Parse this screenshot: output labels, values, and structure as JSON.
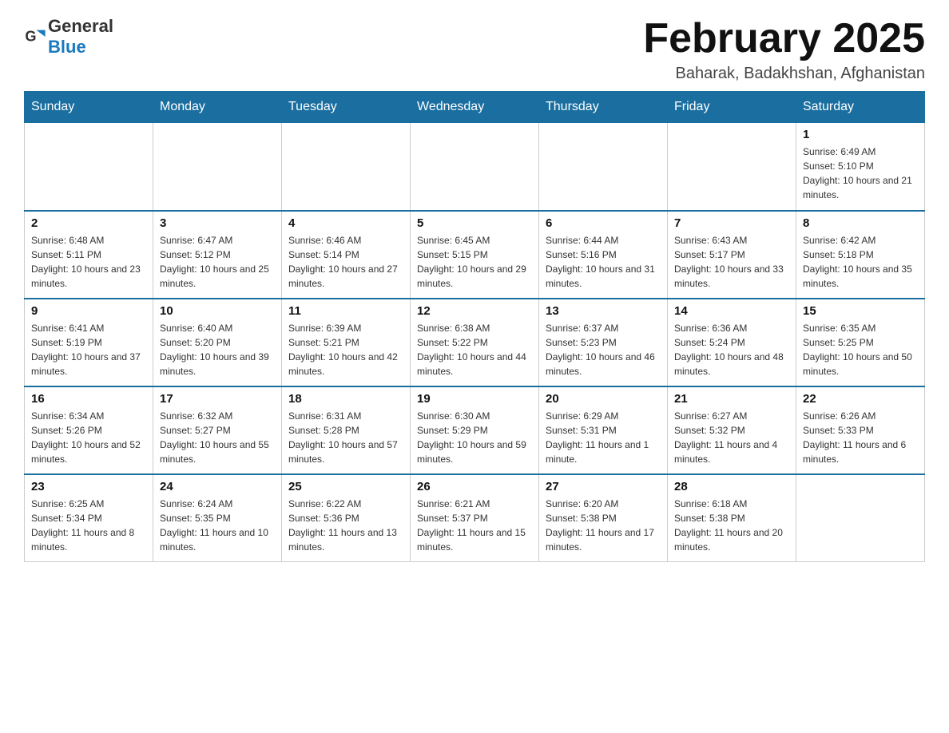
{
  "header": {
    "logo_general": "General",
    "logo_blue": "Blue",
    "month_title": "February 2025",
    "location": "Baharak, Badakhshan, Afghanistan"
  },
  "days_of_week": [
    "Sunday",
    "Monday",
    "Tuesday",
    "Wednesday",
    "Thursday",
    "Friday",
    "Saturday"
  ],
  "weeks": [
    [
      {
        "day": "",
        "info": ""
      },
      {
        "day": "",
        "info": ""
      },
      {
        "day": "",
        "info": ""
      },
      {
        "day": "",
        "info": ""
      },
      {
        "day": "",
        "info": ""
      },
      {
        "day": "",
        "info": ""
      },
      {
        "day": "1",
        "info": "Sunrise: 6:49 AM\nSunset: 5:10 PM\nDaylight: 10 hours and 21 minutes."
      }
    ],
    [
      {
        "day": "2",
        "info": "Sunrise: 6:48 AM\nSunset: 5:11 PM\nDaylight: 10 hours and 23 minutes."
      },
      {
        "day": "3",
        "info": "Sunrise: 6:47 AM\nSunset: 5:12 PM\nDaylight: 10 hours and 25 minutes."
      },
      {
        "day": "4",
        "info": "Sunrise: 6:46 AM\nSunset: 5:14 PM\nDaylight: 10 hours and 27 minutes."
      },
      {
        "day": "5",
        "info": "Sunrise: 6:45 AM\nSunset: 5:15 PM\nDaylight: 10 hours and 29 minutes."
      },
      {
        "day": "6",
        "info": "Sunrise: 6:44 AM\nSunset: 5:16 PM\nDaylight: 10 hours and 31 minutes."
      },
      {
        "day": "7",
        "info": "Sunrise: 6:43 AM\nSunset: 5:17 PM\nDaylight: 10 hours and 33 minutes."
      },
      {
        "day": "8",
        "info": "Sunrise: 6:42 AM\nSunset: 5:18 PM\nDaylight: 10 hours and 35 minutes."
      }
    ],
    [
      {
        "day": "9",
        "info": "Sunrise: 6:41 AM\nSunset: 5:19 PM\nDaylight: 10 hours and 37 minutes."
      },
      {
        "day": "10",
        "info": "Sunrise: 6:40 AM\nSunset: 5:20 PM\nDaylight: 10 hours and 39 minutes."
      },
      {
        "day": "11",
        "info": "Sunrise: 6:39 AM\nSunset: 5:21 PM\nDaylight: 10 hours and 42 minutes."
      },
      {
        "day": "12",
        "info": "Sunrise: 6:38 AM\nSunset: 5:22 PM\nDaylight: 10 hours and 44 minutes."
      },
      {
        "day": "13",
        "info": "Sunrise: 6:37 AM\nSunset: 5:23 PM\nDaylight: 10 hours and 46 minutes."
      },
      {
        "day": "14",
        "info": "Sunrise: 6:36 AM\nSunset: 5:24 PM\nDaylight: 10 hours and 48 minutes."
      },
      {
        "day": "15",
        "info": "Sunrise: 6:35 AM\nSunset: 5:25 PM\nDaylight: 10 hours and 50 minutes."
      }
    ],
    [
      {
        "day": "16",
        "info": "Sunrise: 6:34 AM\nSunset: 5:26 PM\nDaylight: 10 hours and 52 minutes."
      },
      {
        "day": "17",
        "info": "Sunrise: 6:32 AM\nSunset: 5:27 PM\nDaylight: 10 hours and 55 minutes."
      },
      {
        "day": "18",
        "info": "Sunrise: 6:31 AM\nSunset: 5:28 PM\nDaylight: 10 hours and 57 minutes."
      },
      {
        "day": "19",
        "info": "Sunrise: 6:30 AM\nSunset: 5:29 PM\nDaylight: 10 hours and 59 minutes."
      },
      {
        "day": "20",
        "info": "Sunrise: 6:29 AM\nSunset: 5:31 PM\nDaylight: 11 hours and 1 minute."
      },
      {
        "day": "21",
        "info": "Sunrise: 6:27 AM\nSunset: 5:32 PM\nDaylight: 11 hours and 4 minutes."
      },
      {
        "day": "22",
        "info": "Sunrise: 6:26 AM\nSunset: 5:33 PM\nDaylight: 11 hours and 6 minutes."
      }
    ],
    [
      {
        "day": "23",
        "info": "Sunrise: 6:25 AM\nSunset: 5:34 PM\nDaylight: 11 hours and 8 minutes."
      },
      {
        "day": "24",
        "info": "Sunrise: 6:24 AM\nSunset: 5:35 PM\nDaylight: 11 hours and 10 minutes."
      },
      {
        "day": "25",
        "info": "Sunrise: 6:22 AM\nSunset: 5:36 PM\nDaylight: 11 hours and 13 minutes."
      },
      {
        "day": "26",
        "info": "Sunrise: 6:21 AM\nSunset: 5:37 PM\nDaylight: 11 hours and 15 minutes."
      },
      {
        "day": "27",
        "info": "Sunrise: 6:20 AM\nSunset: 5:38 PM\nDaylight: 11 hours and 17 minutes."
      },
      {
        "day": "28",
        "info": "Sunrise: 6:18 AM\nSunset: 5:38 PM\nDaylight: 11 hours and 20 minutes."
      },
      {
        "day": "",
        "info": ""
      }
    ]
  ]
}
